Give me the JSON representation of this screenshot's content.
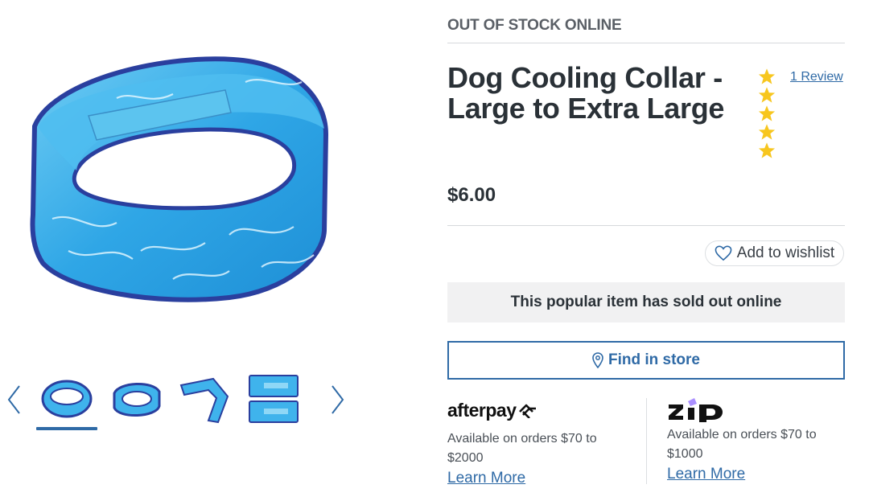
{
  "gallery": {
    "main_image": "dog-cooling-collar-photo",
    "thumbnails": [
      {
        "name": "collar-view-1",
        "active": true
      },
      {
        "name": "collar-view-2",
        "active": false
      },
      {
        "name": "collar-view-3",
        "active": false
      },
      {
        "name": "collar-view-4",
        "active": false
      }
    ],
    "prev_icon": "chevron-left-icon",
    "next_icon": "chevron-right-icon"
  },
  "product": {
    "stock_status": "OUT OF STOCK ONLINE",
    "title": "Dog Cooling Collar - Large to Extra Large",
    "rating_stars": 5,
    "review_link": "1 Review",
    "price": "$6.00"
  },
  "actions": {
    "wishlist_label": "Add to wishlist",
    "wishlist_icon": "heart-icon",
    "soldout_message": "This popular item has sold out online",
    "find_store_label": "Find in store",
    "find_store_icon": "location-pin-icon"
  },
  "payments": {
    "afterpay": {
      "logo_text": "afterpay",
      "description": "Available on orders $70 to $2000",
      "learn_more": "Learn More"
    },
    "zip": {
      "logo_text": "zip",
      "description": "Available on orders $70 to $1000",
      "learn_more": "Learn More"
    }
  },
  "colors": {
    "accent": "#2f6aa6",
    "star": "#f7c61e",
    "collar_light": "#3fb3ec",
    "collar_dark": "#2a3f9e",
    "zip_purple": "#aa8fff"
  }
}
